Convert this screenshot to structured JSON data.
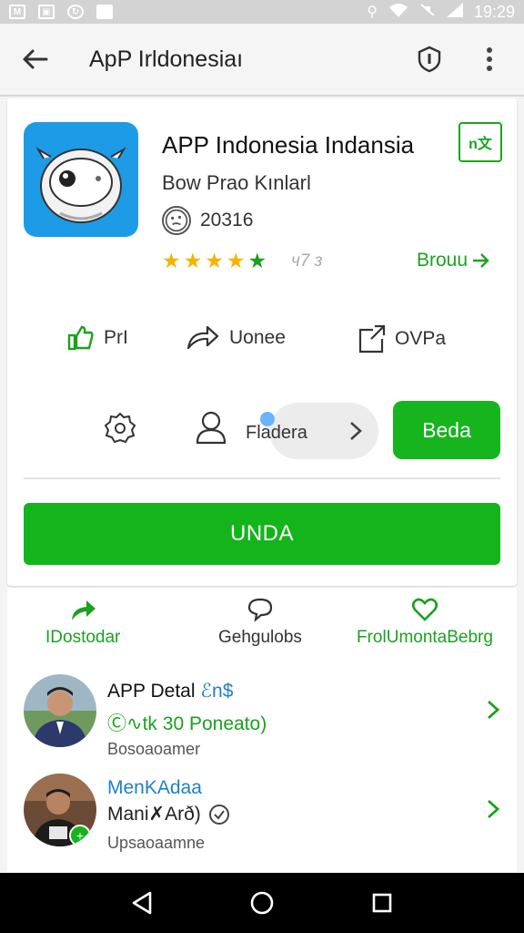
{
  "status_bar": {
    "time": "19:29",
    "left_icons": [
      "gmail-icon",
      "image-icon",
      "sync-icon",
      "square-icon"
    ],
    "right_icons": [
      "nfc-icon",
      "wifi-icon",
      "mute-icon",
      "signal-icon"
    ]
  },
  "app_bar": {
    "title": "ApP Irldonesiaı",
    "back_icon": "arrow-left-icon",
    "actions": [
      "shield-icon",
      "more-vert-icon"
    ]
  },
  "app": {
    "name": "APP Indonesia Indansia",
    "developer": "Bow Prao Kınlarl",
    "downloads": "20316",
    "stars": 5,
    "rating_text": "ч7 з",
    "badge_text": "n文",
    "browse_label": "Brouu",
    "actions": [
      {
        "label": "PrI",
        "icon": "thumbs-up-icon"
      },
      {
        "label": "Uonee",
        "icon": "share-arrow-icon"
      },
      {
        "label": "OVPa",
        "icon": "share-box-icon"
      }
    ],
    "row2": {
      "gear_icon": "badge-gear-icon",
      "person_icon": "person-icon",
      "pill_label": "Fladera",
      "green_button": "Beda"
    },
    "primary_button": "UNDA"
  },
  "tabs": [
    {
      "label": "IDostodar",
      "icon": "share-arrow-icon",
      "color": "#1aa11f"
    },
    {
      "label": "Gehgulobs",
      "icon": "chat-bubble-icon",
      "color": "#333333"
    },
    {
      "label": "FrolUmontaBebrg",
      "icon": "heart-icon",
      "color": "#1aa11f"
    }
  ],
  "list": [
    {
      "title": "APP Detal",
      "title_suffix": "ℰn$",
      "line": "Ⓒ∿tk 30 Poneato)",
      "sub": "Bosoaoamer"
    },
    {
      "title": "MenKAdaa",
      "line": "Mani✗Arð)",
      "line_icon": "check-circle-icon",
      "sub": "Upsaoaamne"
    }
  ],
  "colors": {
    "green": "#14b51b",
    "blue_icon": "#1e9be6",
    "link_blue": "#1e7fcf"
  }
}
